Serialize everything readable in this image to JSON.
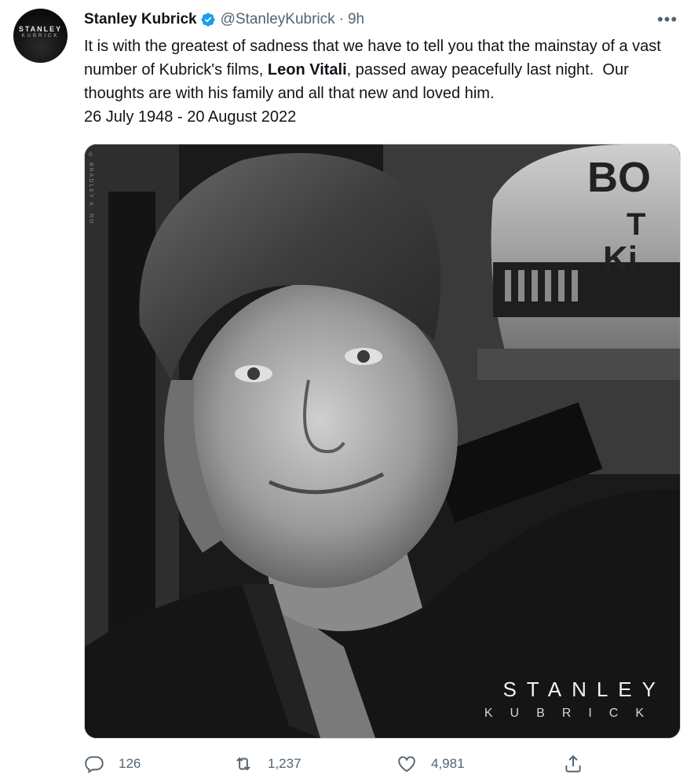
{
  "author": {
    "name": "Stanley Kubrick",
    "handle": "@StanleyKubrick",
    "time": "9h",
    "separator": "·",
    "avatar_line1": "STANLEY",
    "avatar_line2": "KUBRICK"
  },
  "more_label": "•••",
  "tweet": {
    "part1": "It is with the greatest of sadness that we have to tell you that the mainstay of a vast number of Kubrick's films, ",
    "bold": "Leon Vitali",
    "part2": ", passed away peacefully last night.  Our thoughts are with his family and all that new and loved him.\n26 July 1948 - 20 August 2022"
  },
  "media": {
    "watermark_line1": "STANLEY",
    "watermark_line2": "KUBRICK",
    "photo_credit": "© BRADLEY K. RO"
  },
  "actions": {
    "replies": "126",
    "retweets": "1,237",
    "likes": "4,981"
  },
  "colors": {
    "verified": "#1d9bf0",
    "muted": "#536471",
    "text": "#0f1419"
  }
}
